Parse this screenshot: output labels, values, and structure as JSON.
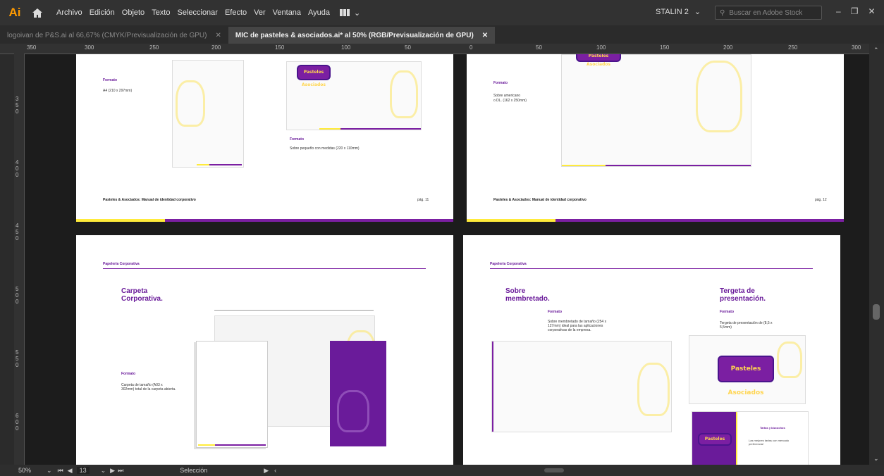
{
  "app": {
    "logo": "Ai",
    "home_icon": "home-icon"
  },
  "menu": [
    "Archivo",
    "Edición",
    "Objeto",
    "Texto",
    "Seleccionar",
    "Efecto",
    "Ver",
    "Ventana",
    "Ayuda"
  ],
  "user": "STALIN 2",
  "search": {
    "placeholder": "Buscar en Adobe Stock"
  },
  "tabs": [
    {
      "label": "logoivan de P&S.ai al 66,67% (CMYK/Previsualización de GPU)",
      "active": false
    },
    {
      "label": "MIC de pasteles & asociados.ai* al 50% (RGB/Previsualización de GPU)",
      "active": true
    }
  ],
  "ruler_h_labels": [
    "350",
    "300",
    "250",
    "200",
    "150",
    "100",
    "50",
    "0",
    "50",
    "100",
    "150",
    "200",
    "250",
    "300"
  ],
  "ruler_v_labels": [
    "350",
    "400",
    "450",
    "500",
    "550",
    "600"
  ],
  "pages": {
    "p11": {
      "formato": "Formato",
      "size": "A4 (210 x 297mm)",
      "formato2": "Formato",
      "sobre": "Sobre pequeño con medidas (220 x 110mm)",
      "footer": "Pasteles & Asociados: Manual de identidad corporativo",
      "page": "pág. 11"
    },
    "p12": {
      "formato": "Formato",
      "sobre": "Sobre americano",
      "size": "o DL. (162 x 250mm)",
      "footer": "Pasteles & Asociados: Manual de identidad corporativo",
      "page": "pág. 12"
    },
    "p13": {
      "section": "Papelería Corporativa",
      "title1": "Carpeta",
      "title2": "Corporativa.",
      "formato": "Formato",
      "desc": "Carpeta de tamaño (A03 x 302mm) total de la carpeta abierta."
    },
    "p14": {
      "section": "Papelería Corporativa",
      "title_a1": "Sobre",
      "title_a2": "membretado.",
      "formato_a": "Formato",
      "desc_a": "Sobre membretado de tamaño (254 x 127mm) ideal para las aplicaciones corporativas de la empresa.",
      "title_b1": "Tergeta de",
      "title_b2": "presentación.",
      "formato_b": "Formato",
      "desc_b": "Tergeta de presentación de (8,5 x 5,5mm)"
    }
  },
  "brand": {
    "logo_text": "Pasteles Asociados",
    "card_logo": "Pasteles",
    "card_text": "Tartas y bizcochos",
    "card_text2": "Las mejores tartas con mercado preferencia!"
  },
  "status": {
    "zoom": "50%",
    "artboard": "13",
    "tool": "Selección"
  },
  "colors": {
    "purple": "#7b1fa2",
    "yellow": "#ffeb3b",
    "accent": "#ff9a00"
  }
}
